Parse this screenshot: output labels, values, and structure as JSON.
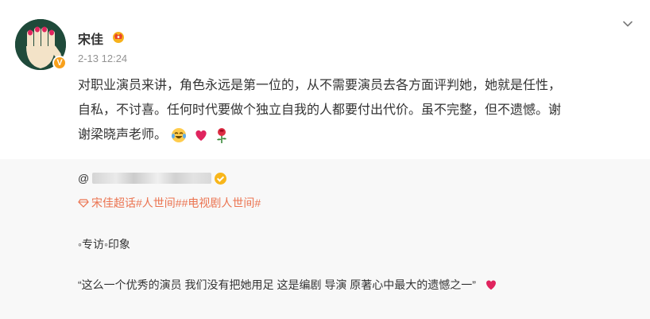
{
  "post": {
    "author": "宋佳",
    "timestamp": "2-13 12:24",
    "text_line1": "对职业演员来讲，角色永远是第一位的，从不需要演员去各方面评判她，她就是任性，",
    "text_line2": "自私，不讨喜。任何时代要做个独立自我的人都要付出代价。虽不完整，但不遗憾。谢",
    "text_line3": "谢梁晓声老师。",
    "verified_badge": "V"
  },
  "repost": {
    "author_prefix": "@",
    "topics": [
      "宋佳超话",
      "#人世间#",
      "#电视剧人世间#"
    ],
    "interview_line": "◦专访◦印象",
    "quote_line": "“这么一个优秀的演员 我们没有把她用足 这是编剧 导演 原著心中最大的遗憾之一”"
  },
  "icons": {
    "more": "chevron-down-icon",
    "crown": "crown-icon",
    "supertopic": "diamond-icon",
    "emoji_1": "laughing-tears-icon",
    "emoji_2": "red-heart-icon",
    "emoji_3": "rose-icon"
  },
  "colors": {
    "link": "#eb7350",
    "meta": "#939393",
    "repost_bg": "#f8f8f8",
    "badge": "#f8a01b"
  }
}
